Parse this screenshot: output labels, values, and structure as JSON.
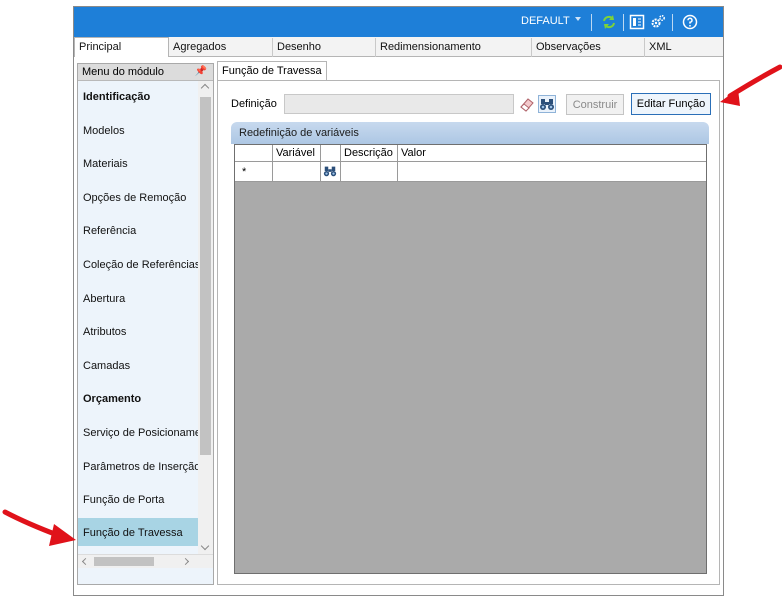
{
  "titlebar": {
    "profile": "DEFAULT",
    "icons": [
      "dropdown-caret-icon",
      "refresh-icon",
      "layout-icon",
      "settings-icon",
      "help-icon"
    ]
  },
  "tabs": [
    {
      "label": "Principal",
      "active": true
    },
    {
      "label": "Agregados",
      "active": false
    },
    {
      "label": "Desenho",
      "active": false
    },
    {
      "label": "Redimensionamento",
      "active": false
    },
    {
      "label": "Observações",
      "active": false
    },
    {
      "label": "XML",
      "active": false
    }
  ],
  "sidebar": {
    "header": "Menu do módulo",
    "items": [
      {
        "label": "Identificação",
        "bold": true
      },
      {
        "label": "Modelos"
      },
      {
        "label": "Materiais"
      },
      {
        "label": "Opções de Remoção"
      },
      {
        "label": "Referência"
      },
      {
        "label": "Coleção de Referências"
      },
      {
        "label": "Abertura"
      },
      {
        "label": "Atributos"
      },
      {
        "label": "Camadas"
      },
      {
        "label": "Orçamento",
        "bold": true
      },
      {
        "label": "Serviço de Posicionamen"
      },
      {
        "label": "Parâmetros de Inserção"
      },
      {
        "label": "Função de Porta"
      },
      {
        "label": "Função de Travessa",
        "selected": true
      }
    ]
  },
  "panel": {
    "tab_label": "Função de Travessa",
    "definition_label": "Definição",
    "definition_value": "",
    "construir_label": "Construir",
    "editar_label": "Editar Função",
    "group_title": "Redefinição de variáveis",
    "grid": {
      "columns": [
        "",
        "Variável",
        "",
        "Descrição",
        "Valor"
      ],
      "new_row_marker": "*"
    }
  },
  "colors": {
    "titlebar": "#1e7fd8",
    "selected_item": "#a8d4e4",
    "annotation_arrow": "#e0121a"
  }
}
